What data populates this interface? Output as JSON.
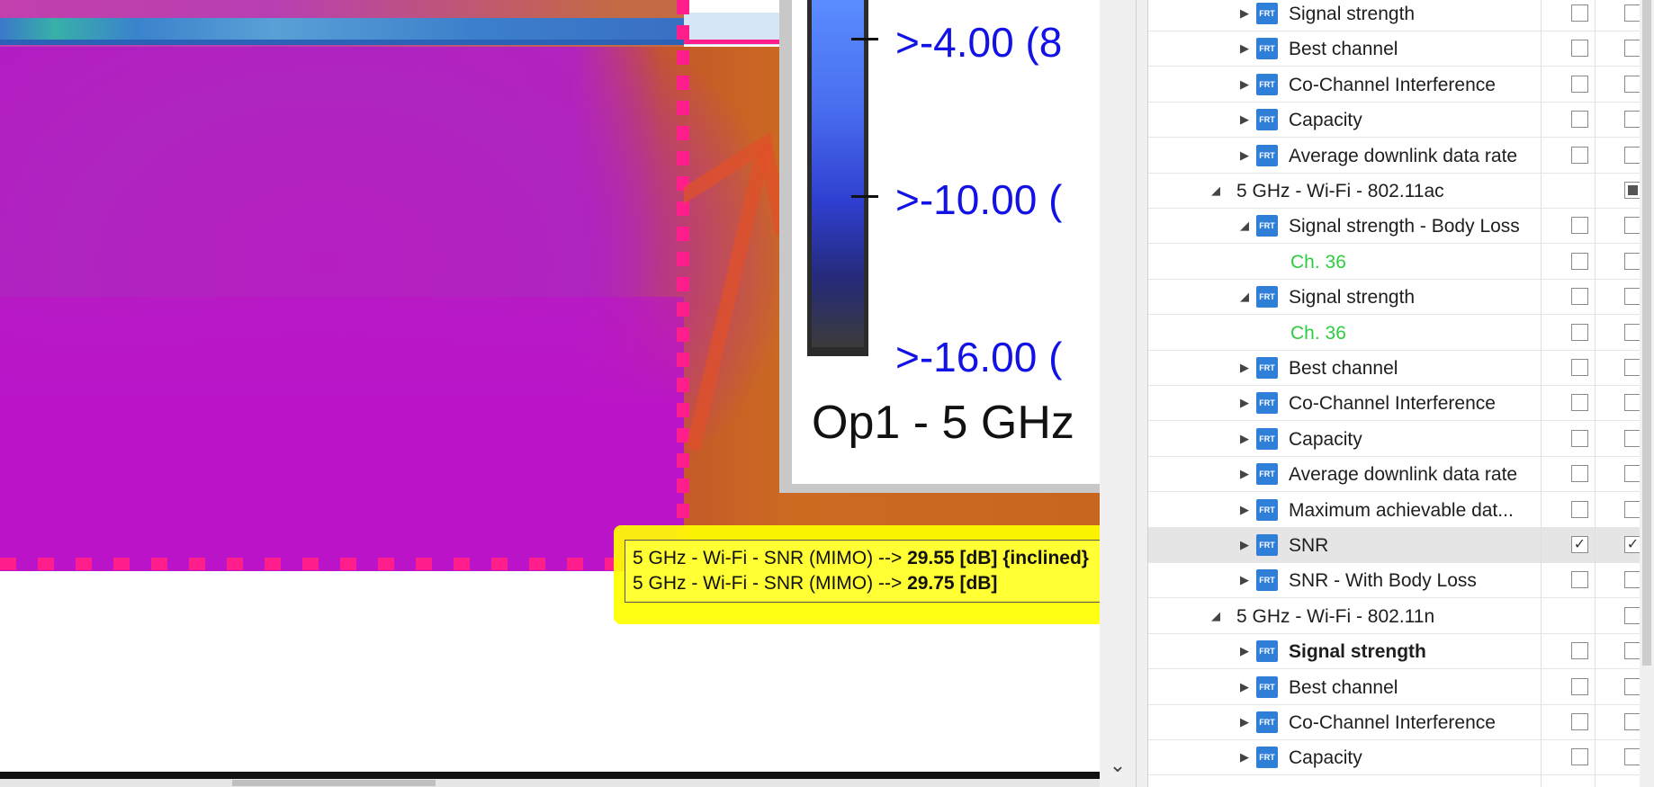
{
  "legend": {
    "labels": [
      ">-4.00 (8",
      ">-10.00 (",
      ">-16.00 ("
    ],
    "title": "Op1 - 5 GHz"
  },
  "tooltip": {
    "line1_prefix": "5 GHz - Wi-Fi -  SNR (MIMO) -->",
    "line1_value": "29.55 [dB] {inclined}",
    "line2_prefix": "5 GHz - Wi-Fi -  SNR (MIMO) -->",
    "line2_value": "29.75 [dB]"
  },
  "tree": {
    "rows": [
      {
        "label": "Signal strength",
        "checked_a": false,
        "checked_b": false
      },
      {
        "label": "Best channel",
        "checked_a": false,
        "checked_b": false
      },
      {
        "label": "Co-Channel Interference",
        "checked_a": false,
        "checked_b": false
      },
      {
        "label": "Capacity",
        "checked_a": false,
        "checked_b": false
      },
      {
        "label": "Average downlink data rate",
        "checked_a": false,
        "checked_b": false
      },
      {
        "label": "5 GHz - Wi-Fi - 802.11ac",
        "checked_b": "indeterminate"
      },
      {
        "label": "Signal strength - Body Loss",
        "checked_a": false,
        "checked_b": false
      },
      {
        "label": "Ch. 36",
        "checked_a": false,
        "checked_b": false
      },
      {
        "label": "Signal strength",
        "checked_a": false,
        "checked_b": false
      },
      {
        "label": "Ch. 36",
        "checked_a": false,
        "checked_b": false
      },
      {
        "label": "Best channel",
        "checked_a": false,
        "checked_b": false
      },
      {
        "label": "Co-Channel Interference",
        "checked_a": false,
        "checked_b": false
      },
      {
        "label": "Capacity",
        "checked_a": false,
        "checked_b": false
      },
      {
        "label": "Average downlink data rate",
        "checked_a": false,
        "checked_b": false
      },
      {
        "label": "Maximum achievable dat...",
        "checked_a": false,
        "checked_b": false
      },
      {
        "label": "SNR",
        "checked_a": true,
        "checked_b": true
      },
      {
        "label": "SNR - With Body Loss",
        "checked_a": false,
        "checked_b": false
      },
      {
        "label": "5 GHz - Wi-Fi - 802.11n",
        "checked_b": false
      },
      {
        "label": "Signal strength",
        "checked_a": false,
        "checked_b": false
      },
      {
        "label": "Best channel",
        "checked_a": false,
        "checked_b": false
      },
      {
        "label": "Co-Channel Interference",
        "checked_a": false,
        "checked_b": false
      },
      {
        "label": "Capacity",
        "checked_a": false,
        "checked_b": false
      }
    ],
    "frt_icon_text": "FRT"
  },
  "colors": {
    "heat_magenta": "#b51fc2",
    "heat_orange": "#cc6a22",
    "legend_text": "#1212e6",
    "tooltip_bg": "#ffff33",
    "highlight": "#ffff00",
    "channel_green": "#2ecc40",
    "boundary_pink": "#ff1e8c"
  }
}
